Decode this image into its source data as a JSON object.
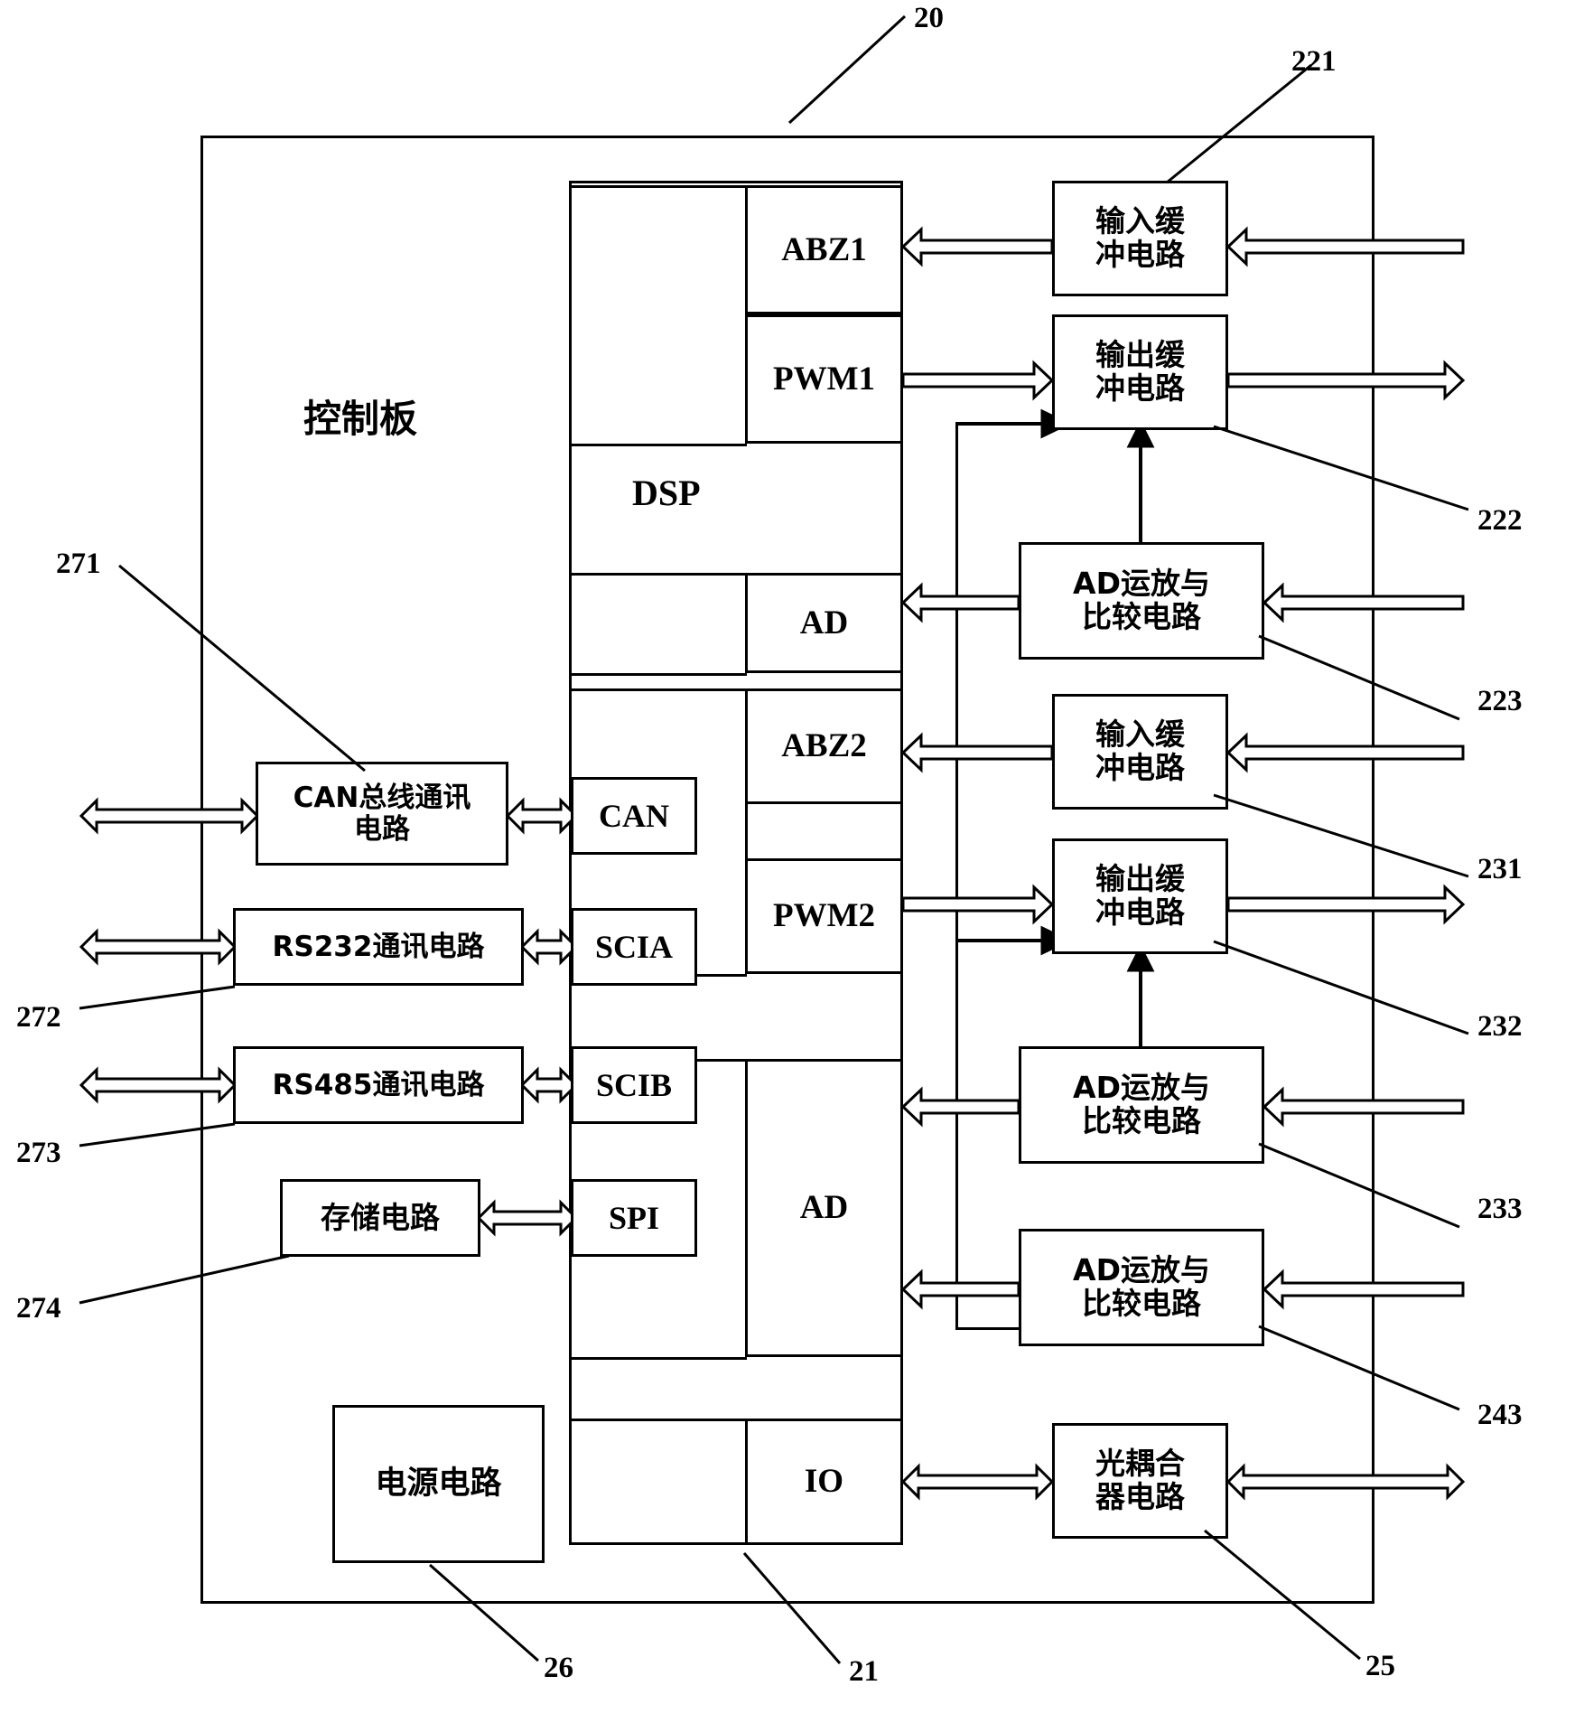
{
  "diagram": {
    "title_ref": "20",
    "board_label": "控制板",
    "dsp_label": "DSP"
  },
  "dsp_ports": [
    {
      "id": "abz1",
      "label": "ABZ1"
    },
    {
      "id": "pwm1",
      "label": "PWM1"
    },
    {
      "id": "ad_top",
      "label": "AD"
    },
    {
      "id": "abz2",
      "label": "ABZ2"
    },
    {
      "id": "pwm2",
      "label": "PWM2"
    },
    {
      "id": "ad_main",
      "label": "AD"
    },
    {
      "id": "io",
      "label": "IO"
    },
    {
      "id": "can",
      "label": "CAN"
    },
    {
      "id": "scia",
      "label": "SCIA"
    },
    {
      "id": "scib",
      "label": "SCIB"
    },
    {
      "id": "spi",
      "label": "SPI"
    }
  ],
  "right_blocks": [
    {
      "id": "input_buf_1",
      "label": "输入缓\n冲电路",
      "ref": "221"
    },
    {
      "id": "output_buf_1",
      "label": "输出缓\n冲电路",
      "ref": "222"
    },
    {
      "id": "ad_amp_1",
      "label": "AD运放与\n比较电路",
      "ref": "223"
    },
    {
      "id": "input_buf_2",
      "label": "输入缓\n冲电路",
      "ref": "231"
    },
    {
      "id": "output_buf_2",
      "label": "输出缓\n冲电路",
      "ref": "232"
    },
    {
      "id": "ad_amp_2",
      "label": "AD运放与\n比较电路",
      "ref": "233"
    },
    {
      "id": "ad_amp_3",
      "label": "AD运放与\n比较电路",
      "ref": "243"
    },
    {
      "id": "optocoupler",
      "label": "光耦合\n器电路",
      "ref": "25"
    }
  ],
  "left_blocks": [
    {
      "id": "can_comm",
      "label": "CAN总线通讯\n电路",
      "ref": "271"
    },
    {
      "id": "rs232_comm",
      "label": "RS232通讯电路",
      "ref": "272"
    },
    {
      "id": "rs485_comm",
      "label": "RS485通讯电路",
      "ref": "273"
    },
    {
      "id": "storage",
      "label": "存储电路",
      "ref": "274"
    },
    {
      "id": "power",
      "label": "电源电路",
      "ref": "26"
    }
  ],
  "reference_numerals": {
    "board": "20",
    "dsp": "21",
    "input_buf_1": "221",
    "output_buf_1": "222",
    "ad_amp_1": "223",
    "input_buf_2": "231",
    "output_buf_2": "232",
    "ad_amp_2": "233",
    "ad_amp_3": "243",
    "optocoupler": "25",
    "power": "26",
    "can_comm": "271",
    "rs232_comm": "272",
    "rs485_comm": "273",
    "storage": "274"
  },
  "colors": {
    "stroke": "#000000",
    "background": "#ffffff"
  }
}
